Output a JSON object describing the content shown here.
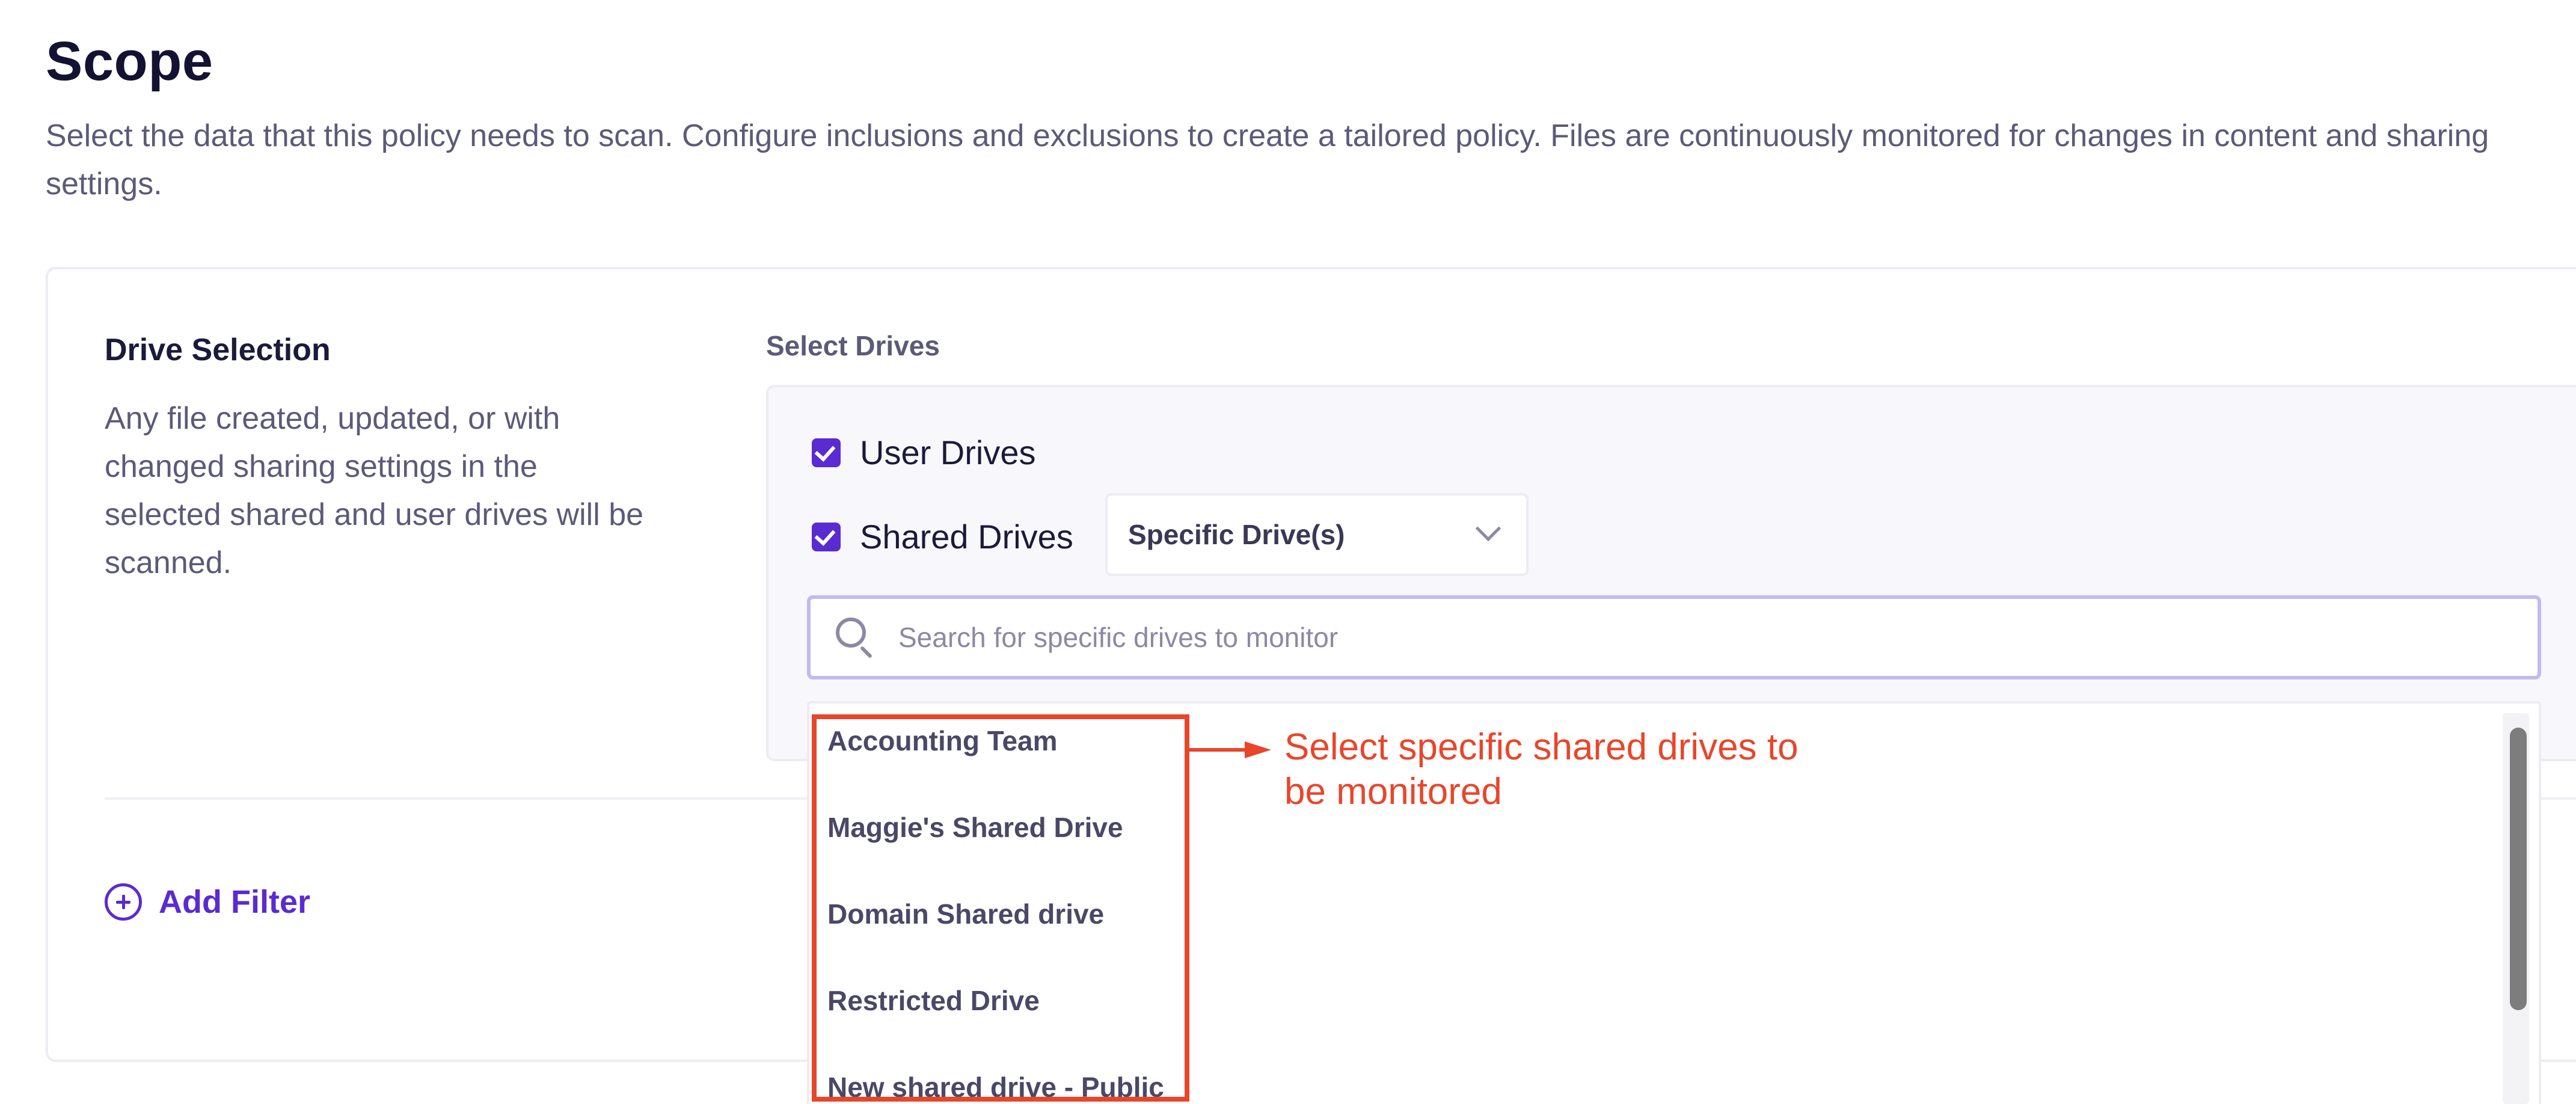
{
  "header": {
    "title": "Scope",
    "description": "Select the data that this policy needs to scan. Configure inclusions and exclusions to create a tailored policy. Files are continuously monitored for changes in content and sharing settings."
  },
  "drive_selection": {
    "title": "Drive Selection",
    "description": "Any file created, updated, or with changed sharing settings in the selected shared and user drives will be scanned."
  },
  "select_drives": {
    "label": "Select Drives",
    "user_drives": {
      "label": "User Drives",
      "checked": true
    },
    "shared_drives": {
      "label": "Shared Drives",
      "checked": true
    },
    "shared_drives_scope": {
      "selected": "Specific Drive(s)"
    },
    "search": {
      "placeholder": "Search for specific drives to monitor",
      "value": ""
    },
    "drives_list": [
      "Accounting Team",
      "Maggie's Shared Drive",
      "Domain Shared drive",
      "Restricted Drive",
      "New shared drive - Public"
    ]
  },
  "add_filter": {
    "label": "Add Filter"
  },
  "annotation": {
    "text": "Select specific shared drives to be monitored"
  },
  "colors": {
    "accent": "#5a2bd0",
    "annotation": "#e8462b",
    "search_border": "#c4b9ef"
  },
  "icons": {
    "checkbox": "checkbox-checked-icon",
    "chevron": "chevron-down-icon",
    "search": "search-icon",
    "add": "plus-circle-icon"
  }
}
